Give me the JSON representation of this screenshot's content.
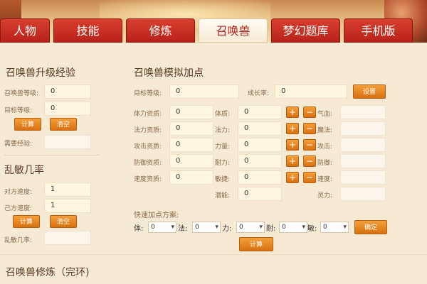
{
  "tabs": [
    "人物",
    "技能",
    "修炼",
    "召唤兽",
    "梦幻题库",
    "手机版"
  ],
  "exp_panel": {
    "title": "召唤兽升级经验",
    "current_level_label": "召唤兽等级:",
    "current_level_value": "0",
    "target_level_label": "目标等级:",
    "target_level_value": "0",
    "calc_label": "计算",
    "clear_label": "清空",
    "need_exp_label": "需要经验:"
  },
  "chaos_panel": {
    "title": "乱敏几率",
    "enemy_speed_label": "对方速度:",
    "enemy_speed_value": "1",
    "own_speed_label": "己方速度:",
    "own_speed_value": "1",
    "calc_label": "计算",
    "clear_label": "清空",
    "chance_label": "乱敏几率:"
  },
  "sim_panel": {
    "title": "召唤兽模拟加点",
    "target_level_label": "目标等级:",
    "target_level_value": "0",
    "growth_label": "成长率:",
    "growth_value": "0",
    "settings_label": "设置",
    "rows": [
      {
        "apt_label": "体力资质:",
        "apt_value": "0",
        "attr_label": "体质:",
        "attr_value": "0",
        "result_label": "气血:"
      },
      {
        "apt_label": "法力资质:",
        "apt_value": "0",
        "attr_label": "法力:",
        "attr_value": "0",
        "result_label": "魔法:"
      },
      {
        "apt_label": "攻击资质:",
        "apt_value": "0",
        "attr_label": "力量:",
        "attr_value": "0",
        "result_label": "攻击:"
      },
      {
        "apt_label": "防御资质:",
        "apt_value": "0",
        "attr_label": "耐力:",
        "attr_value": "0",
        "result_label": "防御:"
      },
      {
        "apt_label": "速度资质:",
        "apt_value": "0",
        "attr_label": "敏捷:",
        "attr_value": "0",
        "result_label": "速度:"
      }
    ],
    "plus": "+",
    "minus": "−",
    "potential_label": "潜能:",
    "potential_value": "0",
    "spirit_label": "灵力:",
    "quick_title": "快速加点方案:",
    "quick": [
      {
        "label": "体:",
        "value": "0"
      },
      {
        "label": "法:",
        "value": "0"
      },
      {
        "label": "力:",
        "value": "0"
      },
      {
        "label": "耐:",
        "value": "0"
      },
      {
        "label": "敏:",
        "value": "0"
      }
    ],
    "confirm_label": "确定",
    "calc_label": "计算"
  },
  "footer": {
    "title": "召唤兽修炼（完环)"
  }
}
